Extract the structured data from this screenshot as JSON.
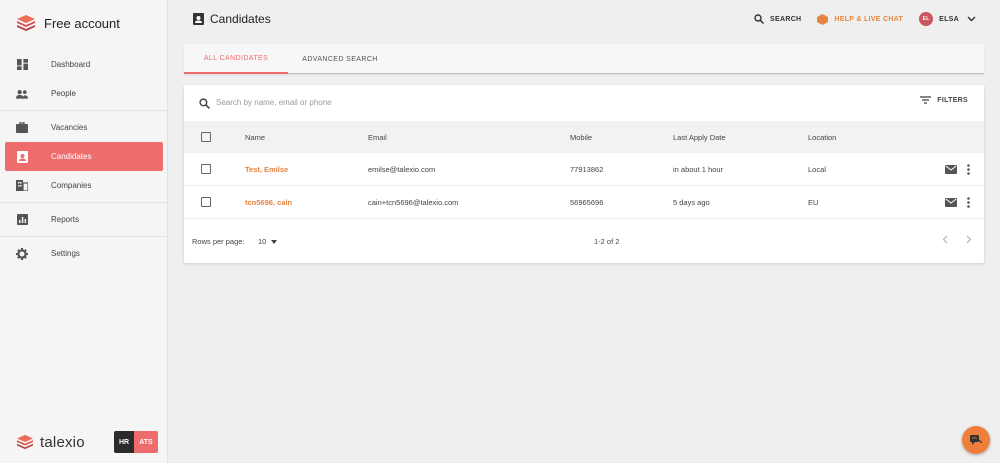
{
  "brand": {
    "title": "Free account",
    "logo_icon": "talexio-cube-icon"
  },
  "sidebar": {
    "items": [
      {
        "label": "Dashboard",
        "icon": "dashboard-icon"
      },
      {
        "label": "People",
        "icon": "people-icon"
      },
      {
        "label": "Vacancies",
        "icon": "briefcase-icon"
      },
      {
        "label": "Candidates",
        "icon": "candidate-card-icon",
        "active": true
      },
      {
        "label": "Companies",
        "icon": "building-icon"
      },
      {
        "label": "Reports",
        "icon": "bar-chart-icon"
      },
      {
        "label": "Settings",
        "icon": "gear-icon"
      }
    ],
    "footer": {
      "wordmark": "talexio",
      "badge_hr": "HR",
      "badge_ats": "ATS"
    }
  },
  "header": {
    "title": "Candidates",
    "search_label": "SEARCH",
    "help_label": "HELP & LIVE CHAT",
    "user_label": "ELSA",
    "user_initials": "EL"
  },
  "tabs": [
    {
      "label": "ALL CANDIDATES",
      "active": true
    },
    {
      "label": "ADVANCED SEARCH",
      "active": false
    }
  ],
  "table": {
    "search_placeholder": "Search by name, email or phone",
    "filters_label": "FILTERS",
    "columns": [
      "Name",
      "Email",
      "Mobile",
      "Last Apply Date",
      "Location"
    ],
    "rows": [
      {
        "name": "Test, Emilse",
        "email": "emilse@talexio.com",
        "mobile": "77913862",
        "last_apply": "in about 1 hour",
        "location": "Local"
      },
      {
        "name": "tcn5696, cain",
        "email": "cain+tcn5696@talexio.com",
        "mobile": "56965696",
        "last_apply": "5 days ago",
        "location": "EU"
      }
    ],
    "footer": {
      "rows_per_page_label": "Rows per page:",
      "rows_per_page_value": "10",
      "range_label": "1-2 of 2"
    }
  },
  "colors": {
    "accent": "#ef6c6c",
    "orange": "#e8843f",
    "fab": "#ef7e3a"
  }
}
